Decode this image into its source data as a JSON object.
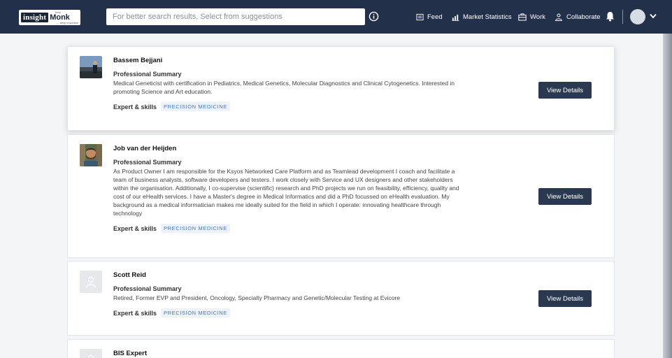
{
  "brand": {
    "insight": "insight",
    "monk": "Monk",
    "beta": "beta",
    "tagline": "... deep expertise"
  },
  "search": {
    "placeholder": "For better search results, Select from suggestions",
    "value": ""
  },
  "nav": {
    "feed": "Feed",
    "market_statistics": "Market Statistics",
    "work": "Work",
    "collaborate": "Collaborate"
  },
  "colors": {
    "navbar": "#23304a",
    "button": "#2b3950",
    "tag_text": "#4a78c2",
    "tag_bg": "#eef2fa"
  },
  "experts": [
    {
      "name": "Bassem Bejjani",
      "summary_title": "Professional Summary",
      "summary_lines": [
        "Medical Geneticist with certification in Pediatrics, Medical Genetics, Molecular Diagnostics and Clinical Cytogenetics. Interested in",
        "promoting Science and Art education."
      ],
      "skills_label": "Expert & skills",
      "skill_tag": "PRECISION MEDICINE",
      "button": "View Details"
    },
    {
      "name": "Job van der Heijden",
      "summary_title": "Professional Summary",
      "summary_lines": [
        "As Product Owner I am responsible for the Ksyos Networked Care Platform and as Teamlead development I coach and facilitate a",
        "team of business analysts, software developers and testers. I work closely with Service and UX designers and other stakeholders",
        "within the organisation. Additionally, I co-supervise (scientific) research and PhD projects we run on feasibility, efficiency, quality and",
        "cost of our eHealth services. I have a Master's degree in Medical Informatics and did a PhD focussed on eHealth evaluation. My",
        "background as a medical informatician makes me ideally suited for the field in which I operate: innovating healthcare through",
        "technology"
      ],
      "skills_label": "Expert & skills",
      "skill_tag": "PRECISION MEDICINE",
      "button": "View Details"
    },
    {
      "name": "Scott Reid",
      "summary_title": "Professional Summary",
      "summary_lines": [
        "Retired, Former EVP and President, Oncology, Specialty Pharmacy and Genetic/Molecular Testing at Evicore"
      ],
      "skills_label": "Expert & skills",
      "skill_tag": "PRECISION MEDICINE",
      "button": "View Details"
    },
    {
      "name": "BIS Expert"
    }
  ]
}
